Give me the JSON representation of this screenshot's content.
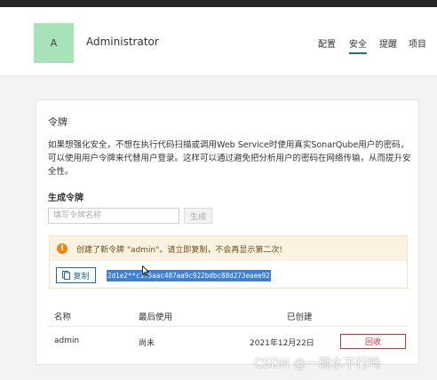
{
  "header": {
    "avatar_initial": "A",
    "username": "Administrator",
    "nav": [
      {
        "label": "配置",
        "active": false
      },
      {
        "label": "安全",
        "active": true
      },
      {
        "label": "提醒",
        "active": false
      },
      {
        "label": "项目",
        "active": false
      }
    ]
  },
  "tokens": {
    "section_title": "令牌",
    "description": "如果想强化安全，不想在执行代码扫描或调用Web Service时使用真实SonarQube用户的密码，可以使用用户令牌来代替用户登录。这样可以通过避免把分析用户的密码在网络传输，从而提升安全性。",
    "generate_title": "生成令牌",
    "name_placeholder": "填写令牌名称",
    "generate_button": "生成",
    "alert_message": "创建了新令牌 \"admin\"。请立即复制，不会再显示第二次!",
    "copy_button": "复制",
    "token_value": "2d1e2**c175aac487aa9c922bdbc88d273eaee92",
    "columns": [
      "名称",
      "最后使用",
      "已创建"
    ],
    "rows": [
      {
        "name": "admin",
        "last_used": "尚未",
        "created": "2021年12月22日",
        "action": "回收"
      }
    ]
  },
  "colors": {
    "accent": "#236a97",
    "warning": "#ec8617",
    "danger": "#d02f3a",
    "avatar_bg": "#a7e2b9"
  },
  "watermark": "CSDN @一碗水不行吗"
}
